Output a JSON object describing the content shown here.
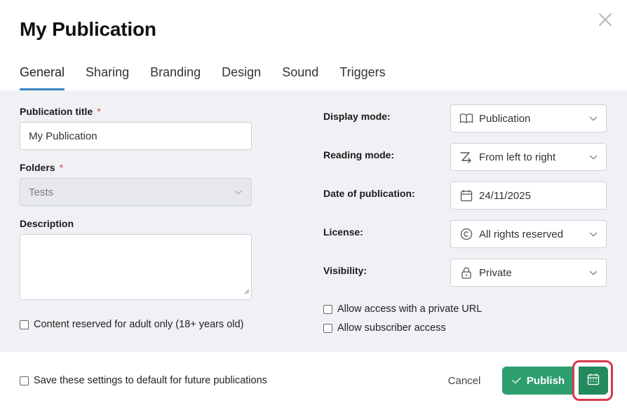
{
  "dialog": {
    "title": "My Publication",
    "tabs": [
      {
        "label": "General",
        "active": true
      },
      {
        "label": "Sharing"
      },
      {
        "label": "Branding"
      },
      {
        "label": "Design"
      },
      {
        "label": "Sound"
      },
      {
        "label": "Triggers"
      }
    ]
  },
  "left": {
    "title_label": "Publication title",
    "required_mark": "*",
    "title_value": "My Publication",
    "folders_label": "Folders",
    "folders_value": "Tests",
    "description_label": "Description",
    "description_value": "",
    "adult_label": "Content reserved for adult only (18+ years old)"
  },
  "right": {
    "display_mode_label": "Display mode:",
    "display_mode_value": "Publication",
    "reading_mode_label": "Reading mode:",
    "reading_mode_value": "From left to right",
    "date_label": "Date of publication:",
    "date_value": "24/11/2025",
    "license_label": "License:",
    "license_value": "All rights reserved",
    "visibility_label": "Visibility:",
    "visibility_value": "Private",
    "private_url_label": "Allow access with a private URL",
    "subscriber_label": "Allow subscriber access"
  },
  "footer": {
    "save_defaults_label": "Save these settings to default for future publications",
    "cancel_label": "Cancel",
    "publish_label": "Publish"
  },
  "colors": {
    "accent_tab": "#3b82c4",
    "publish_green": "#2e9e6e",
    "highlight_red": "#d93a4f",
    "panel_bg": "#eff1f4"
  }
}
